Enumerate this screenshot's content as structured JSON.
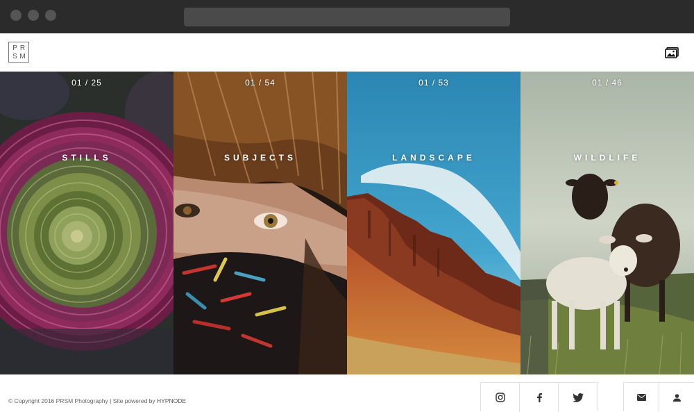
{
  "header": {
    "logo_letters": [
      "P",
      "R",
      "S",
      "M"
    ],
    "gallery_icon": "gallery-icon"
  },
  "panels": [
    {
      "counter": "01 / 25",
      "title": "STILLS"
    },
    {
      "counter": "01 / 54",
      "title": "SUBJECTS"
    },
    {
      "counter": "01 / 53",
      "title": "LANDSCAPE"
    },
    {
      "counter": "01 / 46",
      "title": "WILDLIFE"
    }
  ],
  "footer": {
    "copyright": "© Copyright 2016 PRSM Photography | Site powered by ",
    "powered_by": "HYPNODE",
    "social": [
      "instagram-icon",
      "facebook-icon",
      "twitter-icon"
    ],
    "contact": [
      "mail-icon",
      "user-icon"
    ]
  }
}
